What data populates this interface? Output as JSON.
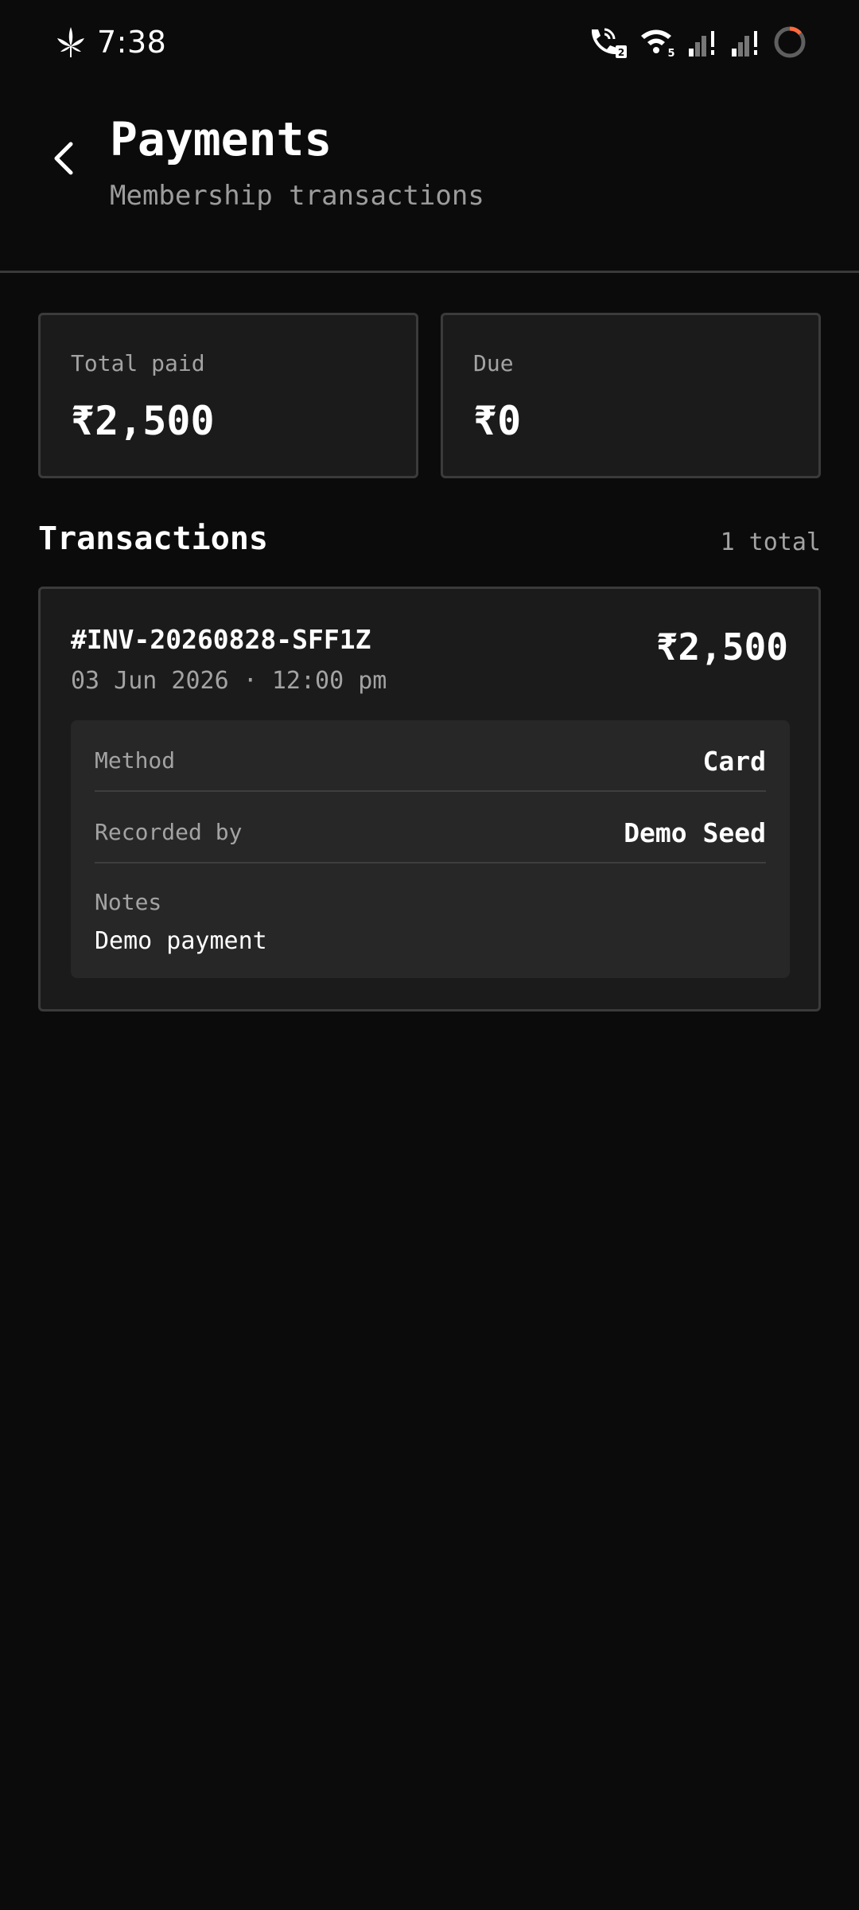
{
  "status_bar": {
    "time": "7:38",
    "call_badge": "2",
    "wifi_badge": "5",
    "icons": [
      "leaf-icon",
      "wifi-call-icon",
      "wifi-icon",
      "signal-icon",
      "signal-icon",
      "battery-ring-icon"
    ],
    "battery_color": "#ff6a3d"
  },
  "header": {
    "title": "Payments",
    "subtitle": "Membership transactions",
    "back_icon": "chevron-left-icon"
  },
  "summary": {
    "total_paid": {
      "label": "Total paid",
      "value": "₹2,500"
    },
    "due": {
      "label": "Due",
      "value": "₹0"
    }
  },
  "transactions": {
    "title": "Transactions",
    "count": "1 total",
    "items": [
      {
        "id": "#INV-20260828-SFF1Z",
        "date": "03 Jun 2026 · 12:00 pm",
        "amount": "₹2,500",
        "method_label": "Method",
        "method": "Card",
        "recorded_by_label": "Recorded by",
        "recorded_by": "Demo Seed",
        "notes_label": "Notes",
        "notes": "Demo payment"
      }
    ]
  },
  "colors": {
    "background": "#0b0b0b",
    "card": "#1b1b1b",
    "card_border": "#3b3b3b",
    "details_panel": "#272727",
    "muted_text": "#a3a3a3"
  }
}
